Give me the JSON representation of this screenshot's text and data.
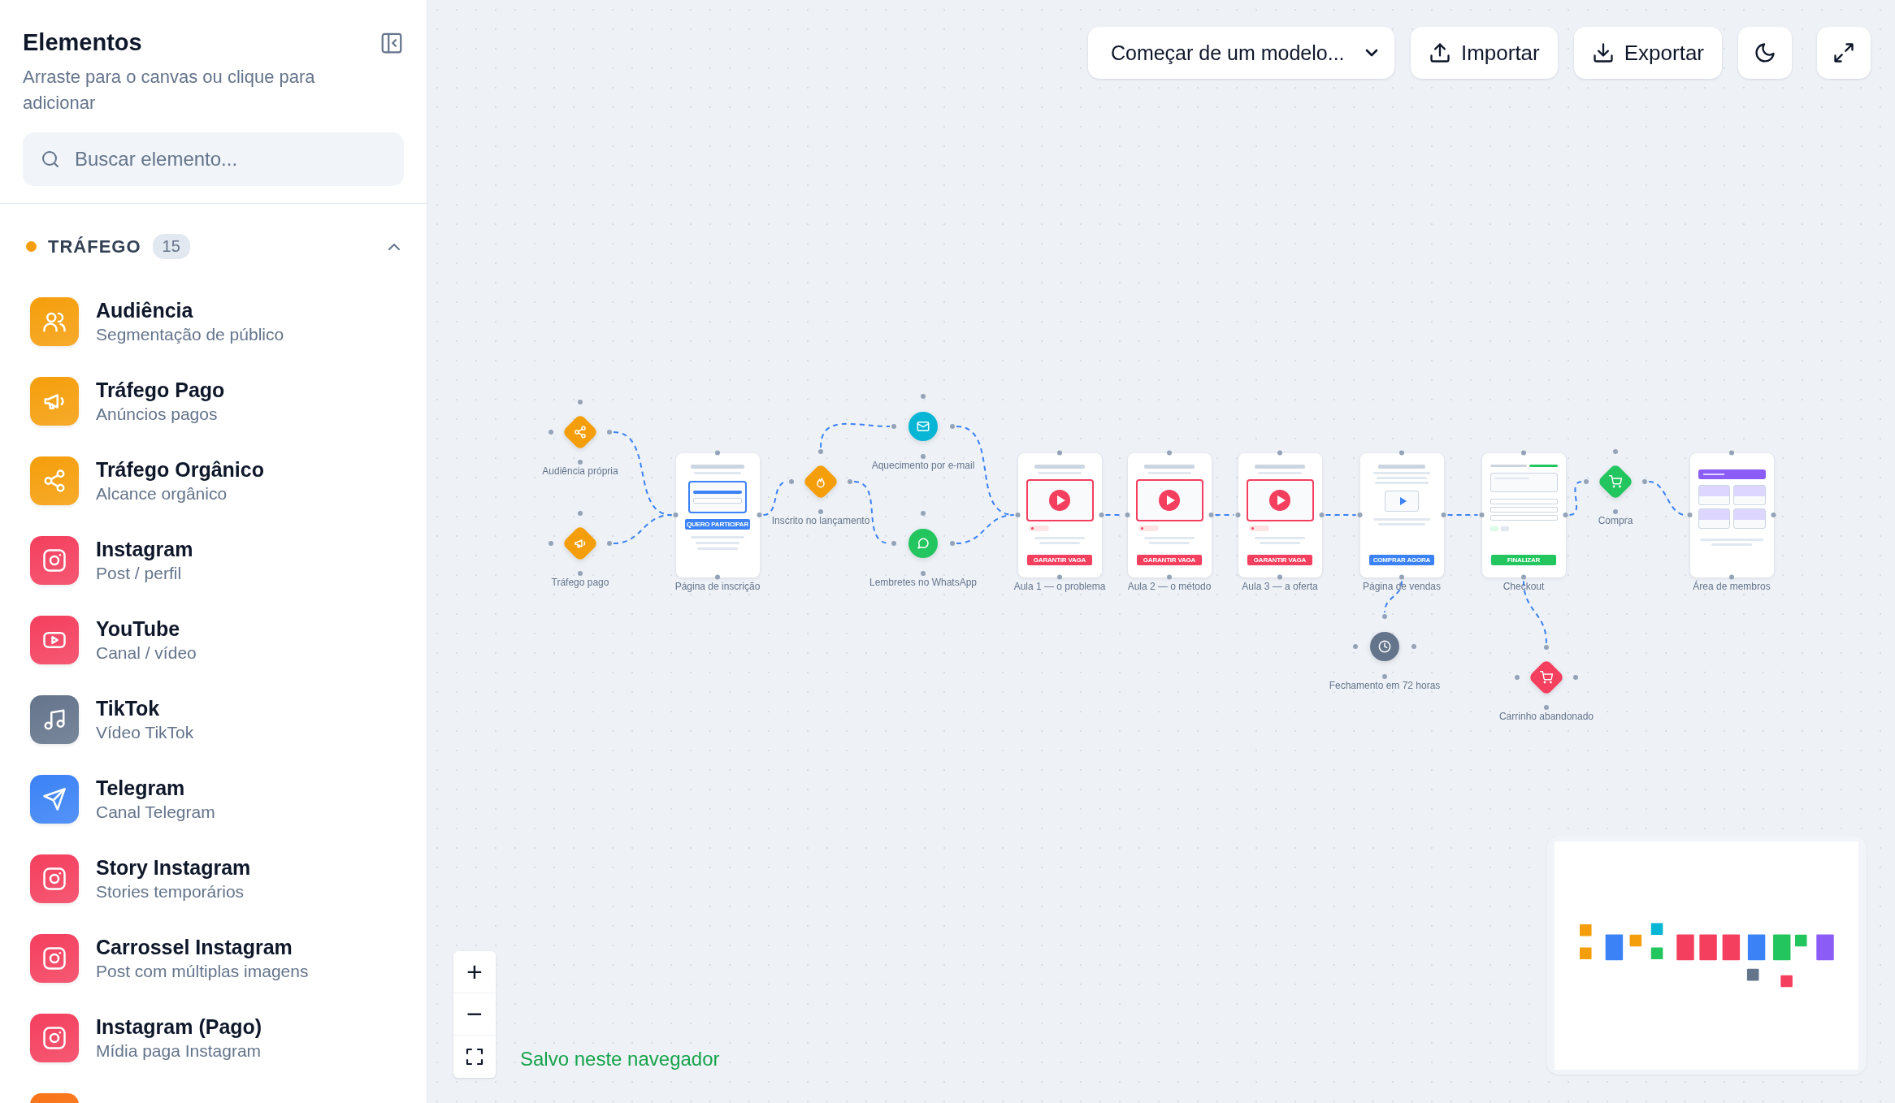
{
  "sidebar": {
    "title": "Elementos",
    "subtitle": "Arraste para o canvas ou clique para adicionar",
    "search": {
      "placeholder": "Buscar elemento..."
    },
    "sections": [
      {
        "title": "TRÁFEGO",
        "count": "15",
        "color": "#f59e0b",
        "expanded": true,
        "items": [
          {
            "title": "Audiência",
            "subtitle": "Segmentação de público",
            "kind": "users",
            "color": "#f59e0b"
          },
          {
            "title": "Tráfego Pago",
            "subtitle": "Anúncios pagos",
            "kind": "megaphone",
            "color": "#f59e0b"
          },
          {
            "title": "Tráfego Orgânico",
            "subtitle": "Alcance orgânico",
            "kind": "share",
            "color": "#f59e0b"
          },
          {
            "title": "Instagram",
            "subtitle": "Post / perfil",
            "kind": "instagram",
            "color": "#f43f5e"
          },
          {
            "title": "YouTube",
            "subtitle": "Canal / vídeo",
            "kind": "youtube",
            "color": "#f43f5e"
          },
          {
            "title": "TikTok",
            "subtitle": "Vídeo TikTok",
            "kind": "music",
            "color": "#64748b"
          },
          {
            "title": "Telegram",
            "subtitle": "Canal Telegram",
            "kind": "send",
            "color": "#3b82f6"
          },
          {
            "title": "Story Instagram",
            "subtitle": "Stories temporários",
            "kind": "instagram",
            "color": "#f43f5e"
          },
          {
            "title": "Carrossel Instagram",
            "subtitle": "Post com múltiplas imagens",
            "kind": "instagram",
            "color": "#f43f5e"
          },
          {
            "title": "Instagram (Pago)",
            "subtitle": "Mídia paga Instagram",
            "kind": "instagram",
            "color": "#f43f5e"
          },
          {
            "color": "#f97316"
          }
        ]
      }
    ]
  },
  "toolbar": {
    "template_dropdown": "Começar de um modelo...",
    "buttons": [
      {
        "label": "Importar",
        "kind": "import"
      },
      {
        "label": "Exportar",
        "kind": "export"
      }
    ],
    "icon_buttons": [
      {
        "kind": "theme"
      },
      {
        "kind": "fullscreen"
      }
    ]
  },
  "flow": {
    "nodes": [
      {
        "label": "Audiência própria",
        "kind": "diamond",
        "color": "#f59e0b"
      },
      {
        "label": "Tráfego pago",
        "kind": "diamond",
        "color": "#f59e0b"
      },
      {
        "label": "Página de inscrição",
        "kind": "page",
        "button": "QUERO PARTICIPAR",
        "color": "#3b82f6"
      },
      {
        "label": "Inscrito no lançamento",
        "kind": "diamond",
        "color": "#f59e0b"
      },
      {
        "label": "Aquecimento por e-mail",
        "kind": "circle",
        "color": "#06b6d4"
      },
      {
        "label": "Lembretes no WhatsApp",
        "kind": "circle",
        "color": "#22c55e"
      },
      {
        "label": "Aula 1 — o problema",
        "kind": "page",
        "button": "GARANTIR VAGA",
        "color": "#f43f5e"
      },
      {
        "label": "Aula 2 — o método",
        "kind": "page",
        "button": "GARANTIR VAGA",
        "color": "#f43f5e"
      },
      {
        "label": "Aula 3 — a oferta",
        "kind": "page",
        "button": "GARANTIR VAGA",
        "color": "#f43f5e"
      },
      {
        "label": "Página de vendas",
        "kind": "page",
        "button": "COMPRAR AGORA",
        "color": "#3b82f6"
      },
      {
        "label": "Fechamento em 72 horas",
        "kind": "circle",
        "color": "#64748b"
      },
      {
        "label": "Checkout",
        "kind": "page",
        "button": "FINALIZAR",
        "color": "#22c55e"
      },
      {
        "label": "Carrinho abandonado",
        "kind": "diamond",
        "color": "#f43f5e"
      },
      {
        "label": "Compra",
        "kind": "diamond",
        "color": "#22c55e"
      },
      {
        "label": "Área de membros",
        "kind": "page",
        "color": "#8b5cf6"
      }
    ]
  },
  "zoom_controls": {
    "zoom_in": "+",
    "zoom_out": "−"
  },
  "save_status": "Salvo neste navegador"
}
